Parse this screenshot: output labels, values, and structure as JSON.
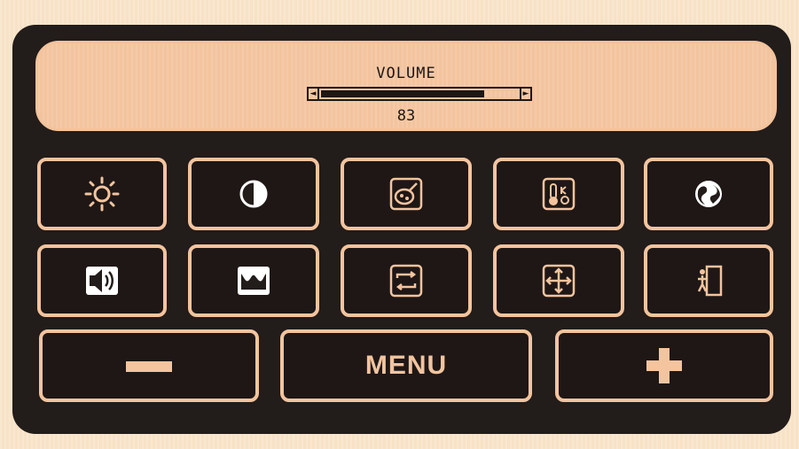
{
  "display": {
    "title": "VOLUME",
    "value": "83",
    "level_percent": 83,
    "left_arrow": "◄",
    "right_arrow": "►"
  },
  "menu_button": {
    "label": "MENU"
  },
  "icons": {
    "row1": [
      "brightness-icon",
      "contrast-icon",
      "color-icon",
      "color-temperature-icon",
      "language-icon"
    ],
    "row2": [
      "volume-icon",
      "image-setup-icon",
      "input-source-icon",
      "position-icon",
      "exit-icon"
    ],
    "row3": [
      "minus-icon",
      "plus-icon"
    ]
  },
  "colors": {
    "panel": "#221c1a",
    "accent": "#f3c49e",
    "ink": "#1e1716",
    "white": "#ffffff"
  }
}
